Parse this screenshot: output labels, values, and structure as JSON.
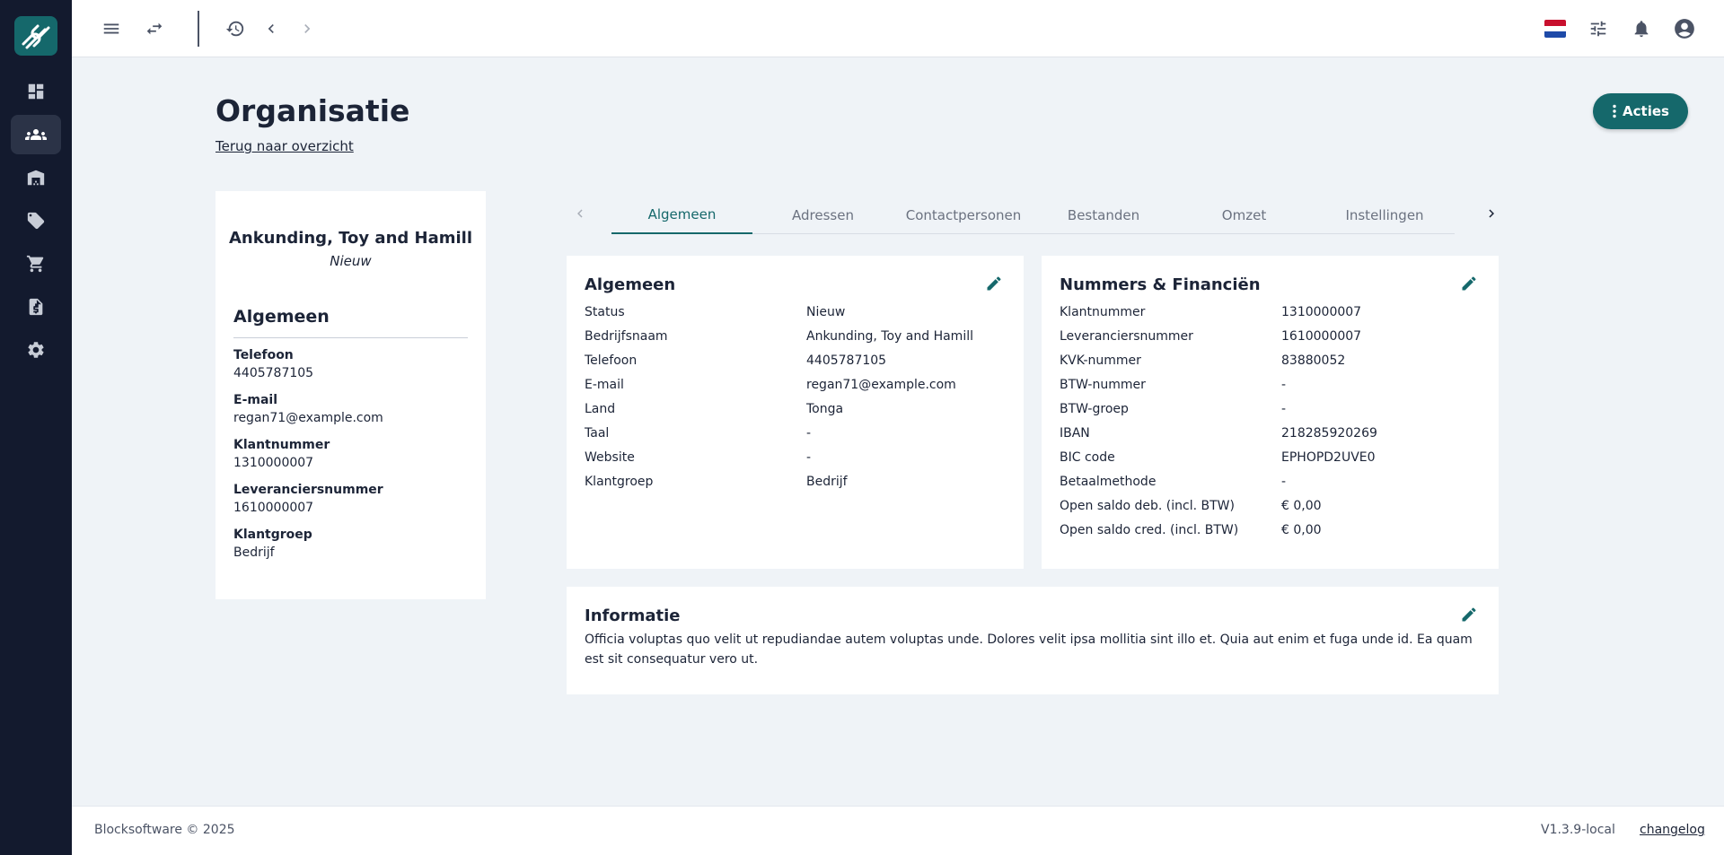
{
  "colors": {
    "sidebar_bg": "#131a2e",
    "accent": "#15686b",
    "page_bg": "#eff3f7"
  },
  "sidebar": {
    "items": [
      {
        "icon": "dashboard-icon"
      },
      {
        "icon": "users-icon"
      },
      {
        "icon": "warehouse-icon"
      },
      {
        "icon": "tag-icon"
      },
      {
        "icon": "cart-icon"
      },
      {
        "icon": "invoice-icon"
      },
      {
        "icon": "gear-icon"
      }
    ]
  },
  "topbar": {
    "icons": [
      "menu-icon",
      "swap-icon",
      "history-icon",
      "chevron-left-icon",
      "chevron-right-icon",
      "flag-nl-icon",
      "tune-icon",
      "bell-icon",
      "account-icon"
    ]
  },
  "header": {
    "title": "Organisatie",
    "back_link": "Terug naar overzicht",
    "actions_label": "Acties"
  },
  "profile": {
    "name": "Ankunding, Toy and Hamill",
    "status": "Nieuw",
    "section_title": "Algemeen",
    "fields": [
      {
        "label": "Telefoon",
        "value": "4405787105"
      },
      {
        "label": "E-mail",
        "value": "regan71@example.com"
      },
      {
        "label": "Klantnummer",
        "value": "1310000007"
      },
      {
        "label": "Leveranciersnummer",
        "value": "1610000007"
      },
      {
        "label": "Klantgroep",
        "value": "Bedrijf"
      }
    ]
  },
  "tabs": [
    {
      "label": "Algemeen",
      "active": true
    },
    {
      "label": "Adressen"
    },
    {
      "label": "Contactpersonen"
    },
    {
      "label": "Bestanden"
    },
    {
      "label": "Omzet"
    },
    {
      "label": "Instellingen"
    }
  ],
  "general": {
    "title": "Algemeen",
    "rows": [
      {
        "label": "Status",
        "value": "Nieuw"
      },
      {
        "label": "Bedrijfsnaam",
        "value": "Ankunding, Toy and Hamill"
      },
      {
        "label": "Telefoon",
        "value": "4405787105"
      },
      {
        "label": "E-mail",
        "value": "regan71@example.com"
      },
      {
        "label": "Land",
        "value": "Tonga"
      },
      {
        "label": "Taal",
        "value": "-"
      },
      {
        "label": "Website",
        "value": "-"
      },
      {
        "label": "Klantgroep",
        "value": "Bedrijf"
      }
    ]
  },
  "finance": {
    "title": "Nummers & Financiën",
    "rows": [
      {
        "label": "Klantnummer",
        "value": "1310000007"
      },
      {
        "label": "Leveranciersnummer",
        "value": "1610000007"
      },
      {
        "label": "KVK-nummer",
        "value": "83880052"
      },
      {
        "label": "BTW-nummer",
        "value": "-"
      },
      {
        "label": "BTW-groep",
        "value": "-"
      },
      {
        "label": "IBAN",
        "value": "218285920269"
      },
      {
        "label": "BIC code",
        "value": "EPHOPD2UVE0"
      },
      {
        "label": "Betaalmethode",
        "value": "-"
      },
      {
        "label": "Open saldo deb. (incl. BTW)",
        "value": "€ 0,00"
      },
      {
        "label": "Open saldo cred. (incl. BTW)",
        "value": "€ 0,00"
      }
    ]
  },
  "information": {
    "title": "Informatie",
    "text": "Officia voluptas quo velit ut repudiandae autem voluptas unde. Dolores velit ipsa mollitia sint illo et. Quia aut enim et fuga unde id. Ea quam est sit consequatur vero ut."
  },
  "footer": {
    "copyright": "Blocksoftware © 2025",
    "version": "V1.3.9-local",
    "changelog": "changelog"
  }
}
